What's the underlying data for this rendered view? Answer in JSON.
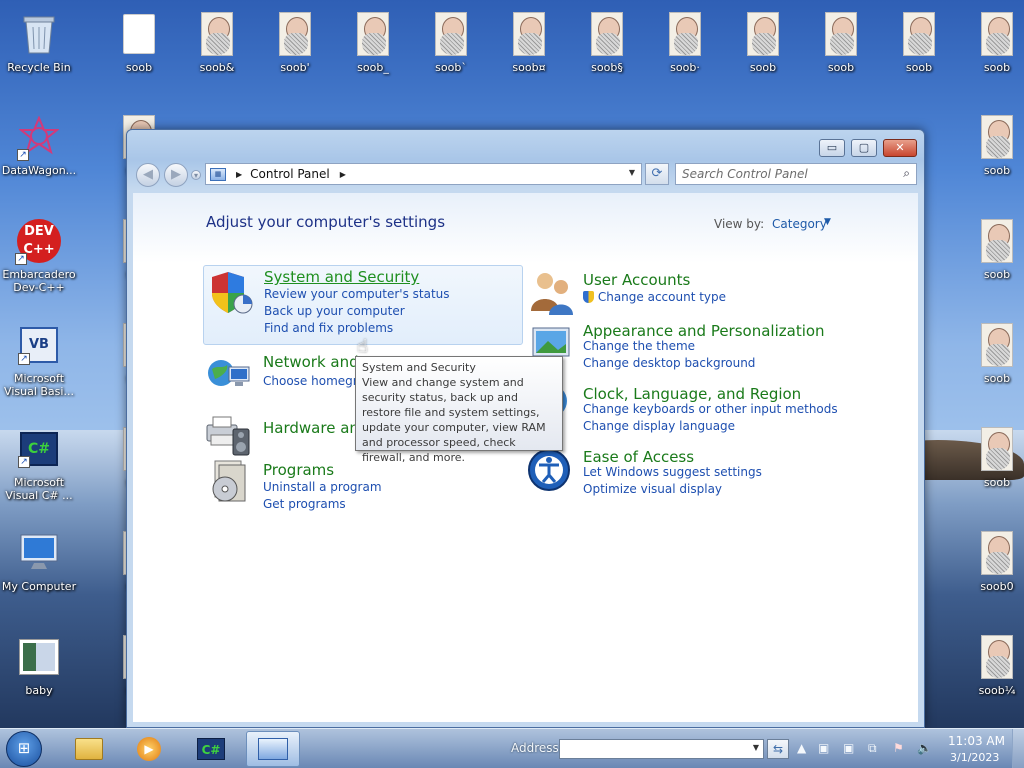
{
  "desktop": {
    "icons": [
      {
        "label": "Recycle Bin",
        "kind": "recycle-bin-icon"
      },
      {
        "label": "soob",
        "kind": "file-icon"
      },
      {
        "label": "soob&",
        "kind": "bitmap-face-icon"
      },
      {
        "label": "soob'",
        "kind": "bitmap-face-icon"
      },
      {
        "label": "soob_",
        "kind": "bitmap-face-icon"
      },
      {
        "label": "soob`",
        "kind": "bitmap-face-icon"
      },
      {
        "label": "soob¤",
        "kind": "bitmap-face-icon"
      },
      {
        "label": "soob§",
        "kind": "bitmap-face-icon"
      },
      {
        "label": "soob·",
        "kind": "bitmap-face-icon"
      },
      {
        "label": "soob",
        "kind": "bitmap-face-icon"
      },
      {
        "label": "soob",
        "kind": "bitmap-face-icon"
      },
      {
        "label": "soob",
        "kind": "bitmap-face-icon"
      },
      {
        "label": "soob",
        "kind": "bitmap-face-icon"
      },
      {
        "label": "DataWagon...",
        "kind": "datawagon-icon"
      },
      {
        "label": "soob",
        "kind": "bitmap-face-icon"
      },
      {
        "label": "soob",
        "kind": "bitmap-face-icon"
      },
      {
        "label": "Embarcadero Dev-C++",
        "kind": "devcpp-icon"
      },
      {
        "label": "soob",
        "kind": "bitmap-face-icon"
      },
      {
        "label": "soob",
        "kind": "bitmap-face-icon"
      },
      {
        "label": "Microsoft Visual Basi...",
        "kind": "visual-basic-icon"
      },
      {
        "label": "soob",
        "kind": "bitmap-face-icon"
      },
      {
        "label": "soob",
        "kind": "bitmap-face-icon"
      },
      {
        "label": "Microsoft Visual C# ...",
        "kind": "visual-csharp-icon"
      },
      {
        "label": "soob",
        "kind": "bitmap-face-icon"
      },
      {
        "label": "soob",
        "kind": "bitmap-face-icon"
      },
      {
        "label": "My Computer",
        "kind": "computer-icon"
      },
      {
        "label": "soob",
        "kind": "bitmap-face-icon"
      },
      {
        "label": "soob0",
        "kind": "bitmap-face-icon"
      },
      {
        "label": "baby",
        "kind": "image-file-icon"
      },
      {
        "label": "soob",
        "kind": "bitmap-face-icon"
      },
      {
        "label": "soob¼",
        "kind": "bitmap-face-icon"
      }
    ]
  },
  "window": {
    "title_buttons": {
      "minimize": "▭",
      "maximize": "▢",
      "close": "✕"
    },
    "nav": {
      "back": "◀",
      "forward": "▶",
      "recent": "▾"
    },
    "address": {
      "crumb": "Control Panel",
      "arrow": "▶",
      "refresh": "⟳"
    },
    "search": {
      "placeholder": "Search Control Panel",
      "icon": "search-icon"
    },
    "page_title": "Adjust your computer's settings",
    "view_by_label": "View by:",
    "view_by_value": "Category",
    "categories_left": [
      {
        "title": "System and Security",
        "links": [
          "Review your computer's status",
          "Back up your computer",
          "Find and fix problems"
        ],
        "icon": "shield-icon"
      },
      {
        "title": "Network and Internet",
        "links": [
          "Choose homegroup and sharing options"
        ],
        "icon": "network-globe-icon"
      },
      {
        "title": "Hardware and Sound",
        "links": [],
        "icon": "printer-speaker-icon"
      },
      {
        "title": "Programs",
        "links": [
          "Uninstall a program",
          "Get programs"
        ],
        "icon": "programs-icon"
      }
    ],
    "categories_right": [
      {
        "title": "User Accounts",
        "links": [
          "Change account type"
        ],
        "icon": "users-icon"
      },
      {
        "title": "Appearance and Personalization",
        "links": [
          "Change the theme",
          "Change desktop background"
        ],
        "icon": "appearance-icon"
      },
      {
        "title": "Clock, Language, and Region",
        "links": [
          "Change keyboards or other input methods",
          "Change display language"
        ],
        "icon": "clock-globe-icon"
      },
      {
        "title": "Ease of Access",
        "links": [
          "Let Windows suggest settings",
          "Optimize visual display"
        ],
        "icon": "ease-of-access-icon"
      }
    ],
    "tooltip": {
      "title": "System and Security",
      "body": "View and change system and security status, back up and restore file and system settings, update your computer, view RAM and processor speed, check firewall, and more."
    }
  },
  "taskbar": {
    "start": "start-orb-icon",
    "apps": [
      {
        "name": "explorer",
        "icon": "folder-icon"
      },
      {
        "name": "media-player",
        "icon": "media-player-icon"
      },
      {
        "name": "visual-csharp",
        "icon": "csharp-icon"
      },
      {
        "name": "control-panel",
        "icon": "control-panel-icon"
      }
    ],
    "address_label": "Address",
    "go": "⇆",
    "time": "11:03 AM",
    "date": "3/1/2023"
  }
}
